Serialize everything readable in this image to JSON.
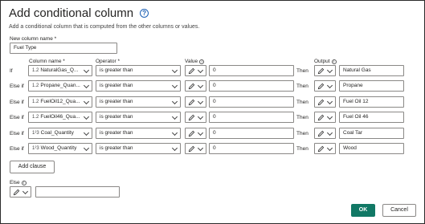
{
  "dialog": {
    "title": "Add conditional column",
    "subtitle": "Add a conditional column that is computed from the other columns or values."
  },
  "new_column": {
    "label": "New column name *",
    "value": "Fuel Type"
  },
  "headers": {
    "column_name": "Column name *",
    "operator": "Operator *",
    "value": "Value",
    "output": "Output"
  },
  "clauses": [
    {
      "prefix": "If",
      "type_icon": "1.2",
      "column": "NaturalGas_Q...",
      "operator": "is greater than",
      "value": "0",
      "then": "Then",
      "output": "Natural Gas"
    },
    {
      "prefix": "Else if",
      "type_icon": "1.2",
      "column": "Propane_Quan...",
      "operator": "is greater than",
      "value": "0",
      "then": "Then",
      "output": "Propane"
    },
    {
      "prefix": "Else if",
      "type_icon": "1.2",
      "column": "FuelOil12_Qua...",
      "operator": "is greater than",
      "value": "0",
      "then": "Then",
      "output": "Fuel Oil 12"
    },
    {
      "prefix": "Else if",
      "type_icon": "1.2",
      "column": "FuelOil46_Qua...",
      "operator": "is greater than",
      "value": "0",
      "then": "Then",
      "output": "Fuel Oil 46"
    },
    {
      "prefix": "Else if",
      "type_icon": "1²3",
      "column": "Coal_Quantity",
      "operator": "is greater than",
      "value": "0",
      "then": "Then",
      "output": "Coal Tar"
    },
    {
      "prefix": "Else if",
      "type_icon": "1²3",
      "column": "Wood_Quantity",
      "operator": "is greater than",
      "value": "0",
      "then": "Then",
      "output": "Wood"
    }
  ],
  "add_clause_label": "Add clause",
  "else": {
    "label": "Else",
    "value": ""
  },
  "buttons": {
    "ok": "OK",
    "cancel": "Cancel"
  },
  "colors": {
    "primary": "#117865",
    "help": "#1a5fb4"
  },
  "icons": {
    "help": "help-circle-icon",
    "pencil": "pencil-icon",
    "chevron": "chevron-down-icon",
    "info": "info-icon"
  }
}
